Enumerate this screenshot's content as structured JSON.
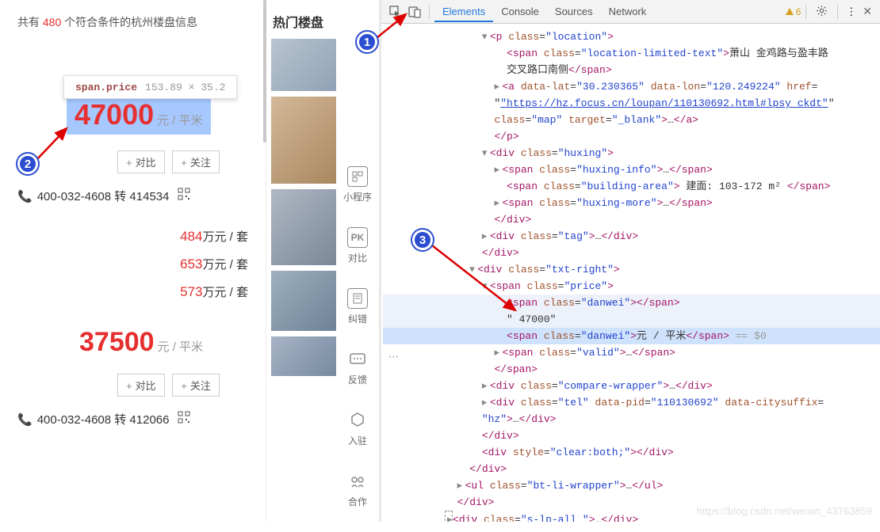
{
  "listing_header": {
    "prefix": "共有 ",
    "count": "480",
    "suffix": " 个符合条件的杭州楼盘信息"
  },
  "tooltip": {
    "selector": "span.price",
    "dimensions": "153.89 × 35.2"
  },
  "listing1": {
    "price": "47000",
    "unit": "元 / 平米",
    "compare_btn": "对比",
    "follow_btn": "关注",
    "tel": "400-032-4608 转 414534",
    "line_prices": [
      {
        "num": "484",
        "unit": "万元 / 套"
      },
      {
        "num": "653",
        "unit": "万元 / 套"
      },
      {
        "num": "573",
        "unit": "万元 / 套"
      }
    ]
  },
  "listing2": {
    "price": "37500",
    "unit": "元 / 平米",
    "compare_btn": "对比",
    "follow_btn": "关注",
    "tel": "400-032-4608 转 412066"
  },
  "mid": {
    "title": "热门楼盘"
  },
  "side_items": [
    {
      "label": "小程序",
      "name": "miniprogram-icon"
    },
    {
      "label": "对比",
      "name": "pk-icon",
      "text": "PK"
    },
    {
      "label": "纠错",
      "name": "report-icon"
    },
    {
      "label": "反馈",
      "name": "feedback-icon"
    },
    {
      "label": "入驻",
      "name": "join-icon"
    },
    {
      "label": "合作",
      "name": "cooperate-icon"
    }
  ],
  "devtools": {
    "tabs": {
      "elements": "Elements",
      "console": "Console",
      "sources": "Sources",
      "network": "Network"
    },
    "warning_count": "6"
  },
  "elements_tree": {
    "l1": "<p class=\"location\">",
    "l2a": "<span class=\"location-limited-text\">",
    "l2b": "萧山 金鸡路与盈丰路",
    "l2c": "交叉路口南侧",
    "l2d": "</span>",
    "l3": "<a data-lat=\"30.230365\" data-lon=\"120.249224\" href=",
    "l3b": "\"https://hz.focus.cn/loupan/110130692.html#lpsy_ckdt\"",
    "l3c": "class=\"map\" target=\"_blank\">…</a>",
    "l4": "</p>",
    "l5": "<div class=\"huxing\">",
    "l6": "<span class=\"huxing-info\">…</span>",
    "l7a": "<span class=\"building-area\"> ",
    "l7b": "建面: 103-172 m²",
    "l7c": " </span>",
    "l8": "<span class=\"huxing-more\">…</span>",
    "l9": "</div>",
    "l10": "<div class=\"tag\">…</div>",
    "l11": "</div>",
    "l12": "<div class=\"txt-right\">",
    "l13": "<span class=\"price\">",
    "l14": "<span class=\"danwei\"></span>",
    "l15": "\" 47000\"",
    "l16a": "<span class=\"danwei\">",
    "l16b": "元 / 平米",
    "l16c": "</span>",
    "l16d": " == $0",
    "l17": "<span class=\"valid\">…</span>",
    "l18": "</span>",
    "l19": "<div class=\"compare-wrapper\">…</div>",
    "l20": "<div class=\"tel\" data-pid=\"110130692\" data-citysuffix=",
    "l20b": "\"hz\">…</div>",
    "l21": "</div>",
    "l22": "<div style=\"clear:both;\"></div>",
    "l23": "</div>",
    "l24": "<ul class=\"bt-li-wrapper\">…</ul>",
    "l25": "</div>",
    "l26": "<div class=\"s-lp-all \">…</div>"
  },
  "watermark": "https://blog.csdn.net/weixin_43763859"
}
